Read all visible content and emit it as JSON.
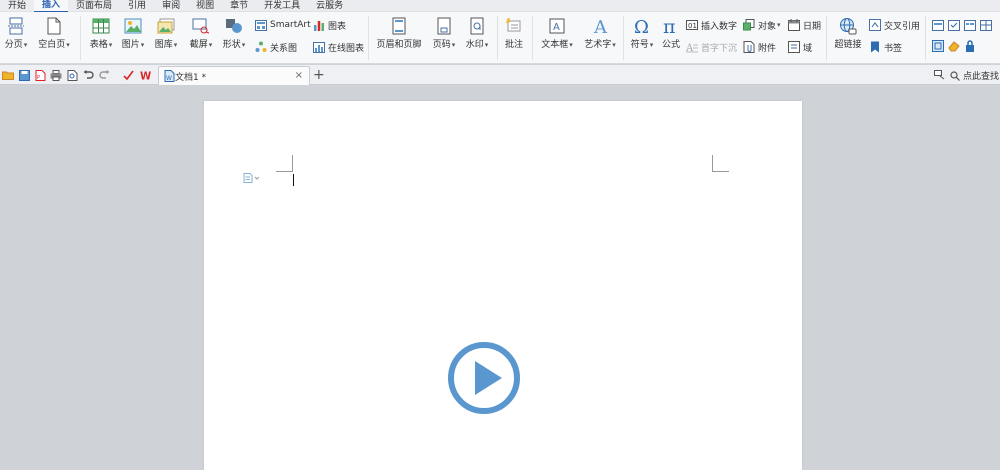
{
  "menu": {
    "tabs": [
      "开始",
      "插入",
      "页面布局",
      "引用",
      "审阅",
      "视图",
      "章节",
      "开发工具",
      "云服务"
    ],
    "active_tab": "插入"
  },
  "ribbon": {
    "page_break": "分页",
    "blank_page": "空白页",
    "table": "表格",
    "picture": "图片",
    "gallery": "图库",
    "screenshot": "截屏",
    "shapes": "形状",
    "smartart": "SmartArt",
    "relation_chart": "关系图",
    "chart": "图表",
    "online_chart": "在线图表",
    "header_footer": "页眉和页脚",
    "page_number": "页码",
    "watermark": "水印",
    "comment": "批注",
    "textbox": "文本框",
    "wordart": "艺术字",
    "symbol": "符号",
    "formula": "公式",
    "insert_number": "插入数字",
    "drop_cap": "首字下沉",
    "object": "对象",
    "attachment": "附件",
    "date": "日期",
    "field": "域",
    "hyperlink": "超链接",
    "cross_reference": "交叉引用",
    "bookmark": "书签"
  },
  "tabbar": {
    "doc_name": "文档1 *",
    "close_icon": "×",
    "add_icon": "+",
    "search_label": "点此查找"
  },
  "colors": {
    "accent": "#2b5fb3",
    "play_button": "#5a97cf",
    "workspace": "#cfd2d7",
    "wps_red": "#d9262b"
  }
}
